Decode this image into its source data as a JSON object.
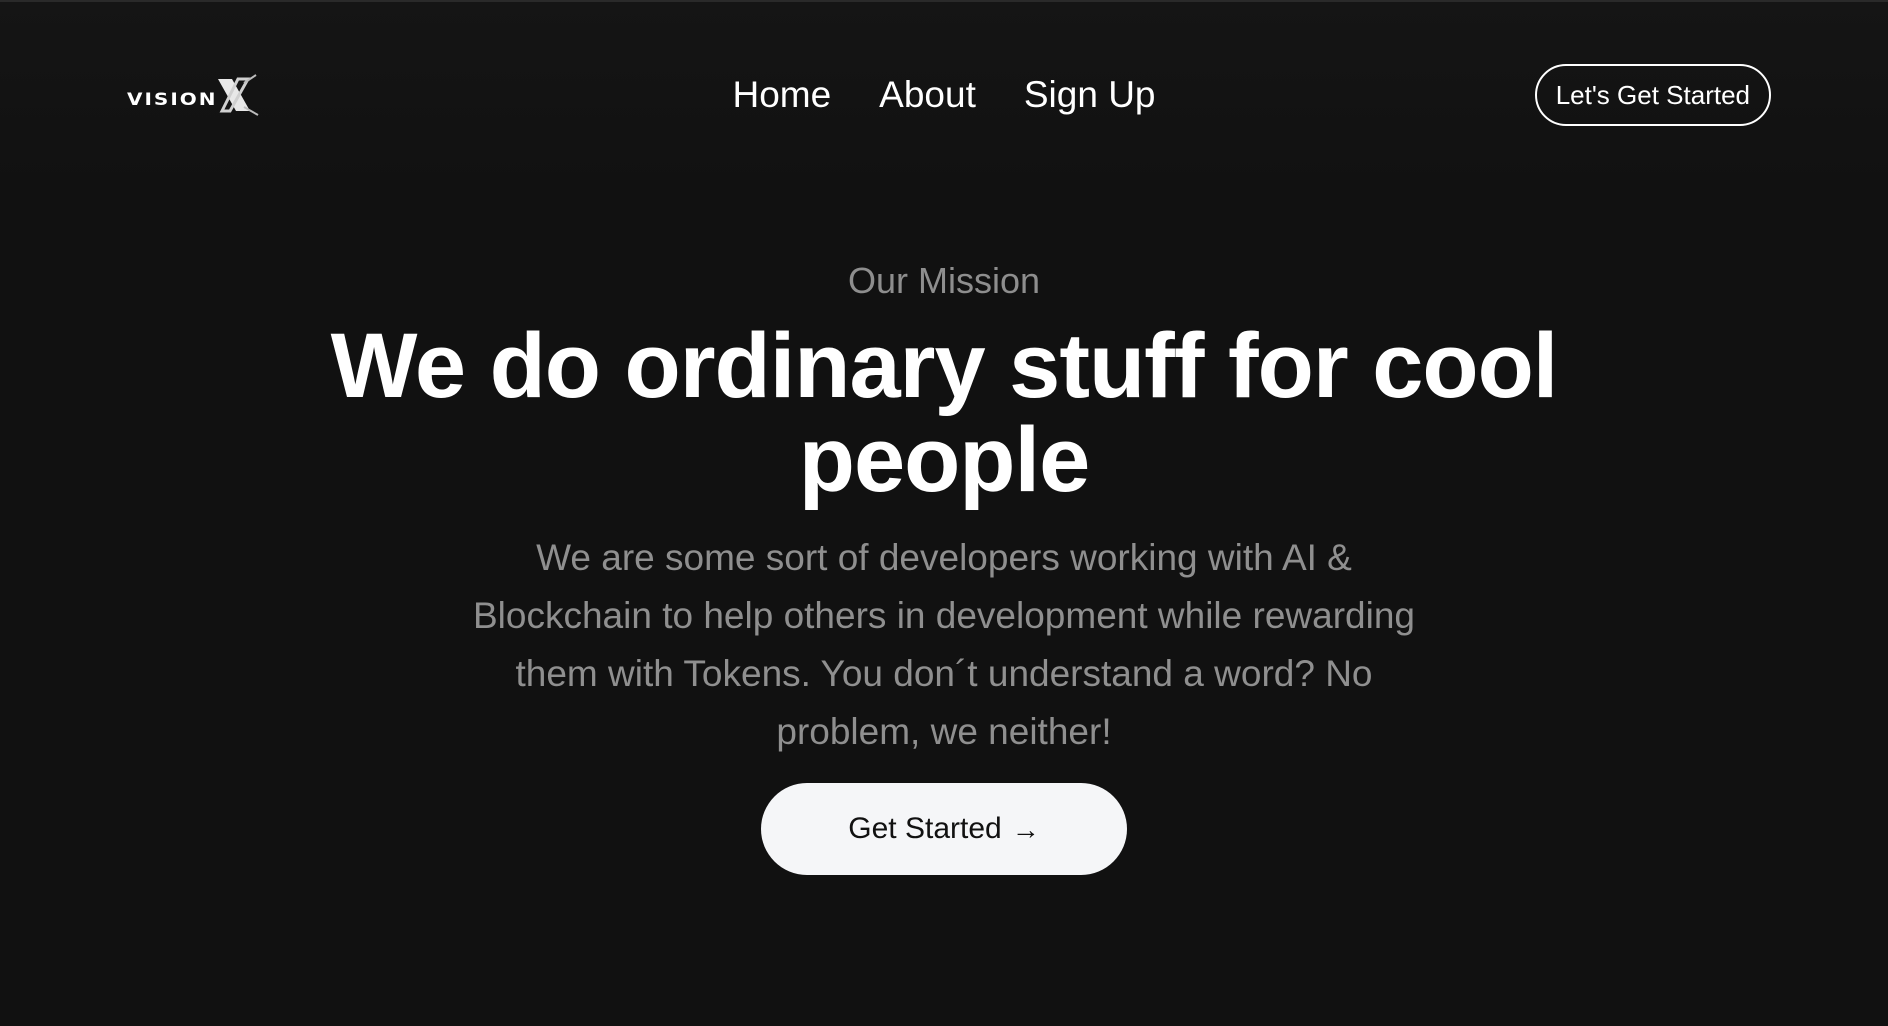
{
  "brand": {
    "logo_text": "VISION",
    "logo_mark": "X"
  },
  "nav": {
    "items": [
      {
        "label": "Home"
      },
      {
        "label": "About"
      },
      {
        "label": "Sign Up"
      }
    ],
    "cta_label": "Let's Get Started"
  },
  "hero": {
    "eyebrow": "Our Mission",
    "headline": "We do ordinary stuff for cool people",
    "description": "We are some sort of developers working with AI & Blockchain to help others in development while rewarding them with Tokens. You don´t understand a word? No problem, we neither!",
    "cta_label": "Get Started",
    "cta_icon": "arrow-right-icon"
  },
  "colors": {
    "background": "#111111",
    "text_primary": "#ffffff",
    "text_muted": "#8f8f8f",
    "button_light": "#f5f6f8"
  }
}
